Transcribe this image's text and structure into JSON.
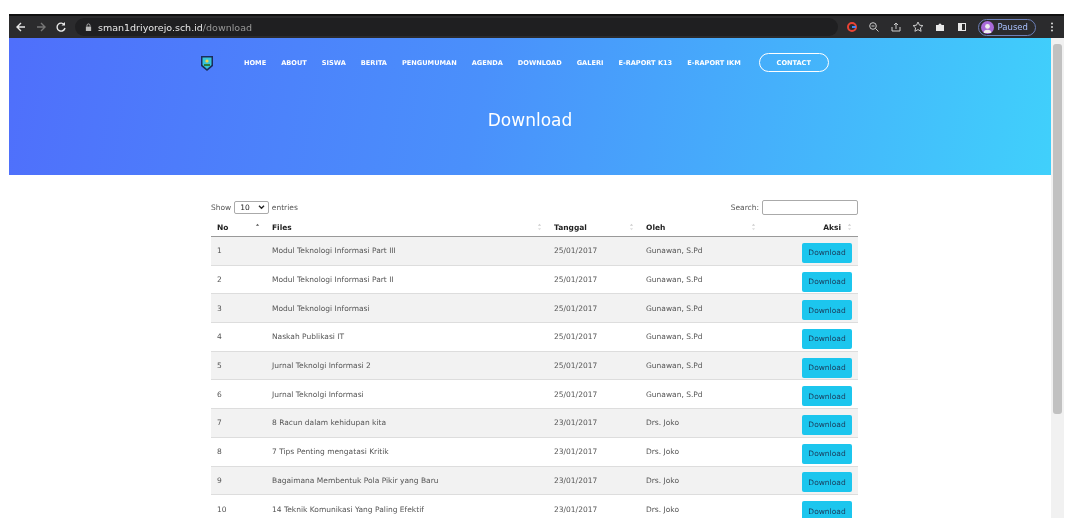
{
  "browser": {
    "url_host": "sman1driyorejo.sch.id",
    "url_path": "/download",
    "profile": "Paused"
  },
  "nav": {
    "items": [
      "HOME",
      "ABOUT",
      "SISWA",
      "BERITA",
      "PENGUMUMAN",
      "AGENDA",
      "DOWNLOAD",
      "GALERI",
      "E-RAPORT K13",
      "E-RAPORT IKM"
    ],
    "contact": "CONTACT"
  },
  "hero": {
    "title": "Download"
  },
  "table_controls": {
    "show_label": "Show",
    "entries_value": "10",
    "entries_label": "entries",
    "search_label": "Search:"
  },
  "table": {
    "columns": [
      {
        "label": "No",
        "sorted": true
      },
      {
        "label": "Files",
        "sorted": false
      },
      {
        "label": "Tanggal",
        "sorted": false
      },
      {
        "label": "Oleh",
        "sorted": false
      },
      {
        "label": "Aksi",
        "sorted": false
      }
    ],
    "rows": [
      {
        "no": "1",
        "file": "Modul Teknologi Informasi Part III",
        "date": "25/01/2017",
        "by": "Gunawan, S.Pd",
        "action": "Download"
      },
      {
        "no": "2",
        "file": "Modul Teknologi Informasi Part II",
        "date": "25/01/2017",
        "by": "Gunawan, S.Pd",
        "action": "Download"
      },
      {
        "no": "3",
        "file": "Modul Teknologi Informasi",
        "date": "25/01/2017",
        "by": "Gunawan, S.Pd",
        "action": "Download"
      },
      {
        "no": "4",
        "file": "Naskah Publikasi IT",
        "date": "25/01/2017",
        "by": "Gunawan, S.Pd",
        "action": "Download"
      },
      {
        "no": "5",
        "file": "Jurnal Teknolgi Informasi 2",
        "date": "25/01/2017",
        "by": "Gunawan, S.Pd",
        "action": "Download"
      },
      {
        "no": "6",
        "file": "Jurnal Teknolgi Informasi",
        "date": "25/01/2017",
        "by": "Gunawan, S.Pd",
        "action": "Download"
      },
      {
        "no": "7",
        "file": "8 Racun dalam kehidupan kita",
        "date": "23/01/2017",
        "by": "Drs. Joko",
        "action": "Download"
      },
      {
        "no": "8",
        "file": "7 Tips Penting mengatasi Kritik",
        "date": "23/01/2017",
        "by": "Drs. Joko",
        "action": "Download"
      },
      {
        "no": "9",
        "file": "Bagaimana Membentuk Pola Pikir yang Baru",
        "date": "23/01/2017",
        "by": "Drs. Joko",
        "action": "Download"
      },
      {
        "no": "10",
        "file": "14 Teknik Komunikasi Yang Paling Efektif",
        "date": "23/01/2017",
        "by": "Drs. Joko",
        "action": "Download"
      }
    ]
  }
}
